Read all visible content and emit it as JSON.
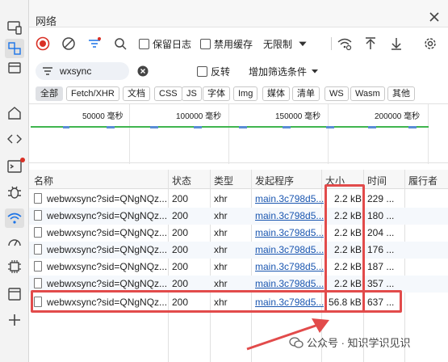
{
  "panel": {
    "title": "网络"
  },
  "toolbar": {
    "preserve_log": "保留日志",
    "disable_cache": "禁用缓存",
    "throttle": "无限制"
  },
  "filter": {
    "value": "wxsync",
    "invert": "反转",
    "more_filters": "增加筛选条件"
  },
  "types": [
    "全部",
    "Fetch/XHR",
    "文档",
    "CSS",
    "JS",
    "字体",
    "Img",
    "媒体",
    "清单",
    "WS",
    "Wasm",
    "其他"
  ],
  "overview": {
    "ticks": [
      "50000 毫秒",
      "100000 毫秒",
      "150000 毫秒",
      "200000 毫秒"
    ]
  },
  "table": {
    "headers": [
      "名称",
      "状态",
      "类型",
      "发起程序",
      "大小",
      "时间",
      "履行者"
    ],
    "rows": [
      {
        "name": "webwxsync?sid=QNgNQz...",
        "status": "200",
        "type": "xhr",
        "initiator": "main.3c798d5...",
        "size": "2.2 kB",
        "time": "229 ..."
      },
      {
        "name": "webwxsync?sid=QNgNQz...",
        "status": "200",
        "type": "xhr",
        "initiator": "main.3c798d5...",
        "size": "2.2 kB",
        "time": "180 ..."
      },
      {
        "name": "webwxsync?sid=QNgNQz...",
        "status": "200",
        "type": "xhr",
        "initiator": "main.3c798d5...",
        "size": "2.2 kB",
        "time": "204 ..."
      },
      {
        "name": "webwxsync?sid=QNgNQz...",
        "status": "200",
        "type": "xhr",
        "initiator": "main.3c798d5...",
        "size": "2.2 kB",
        "time": "176 ..."
      },
      {
        "name": "webwxsync?sid=QNgNQz...",
        "status": "200",
        "type": "xhr",
        "initiator": "main.3c798d5...",
        "size": "2.2 kB",
        "time": "187 ..."
      },
      {
        "name": "webwxsync?sid=QNgNQz...",
        "status": "200",
        "type": "xhr",
        "initiator": "main.3c798d5...",
        "size": "2.2 kB",
        "time": "357 ..."
      },
      {
        "name": "webwxsync?sid=QNgNQz...",
        "status": "200",
        "type": "xhr",
        "initiator": "main.3c798d5...",
        "size": "56.8 kB",
        "time": "637 ..."
      }
    ]
  },
  "watermark": "公众号 · 知识学识见识",
  "colors": {
    "highlight": "#e24b4b",
    "record": "#d93025",
    "link": "#1a56b0",
    "timeline_green": "#40b54f"
  },
  "icons": [
    "device-toolbar-icon",
    "inspect-icon",
    "panel-icon",
    "home-icon",
    "sources-icon",
    "console-icon",
    "bug-icon",
    "network-icon",
    "performance-icon",
    "memory-icon",
    "application-icon",
    "add-icon"
  ]
}
